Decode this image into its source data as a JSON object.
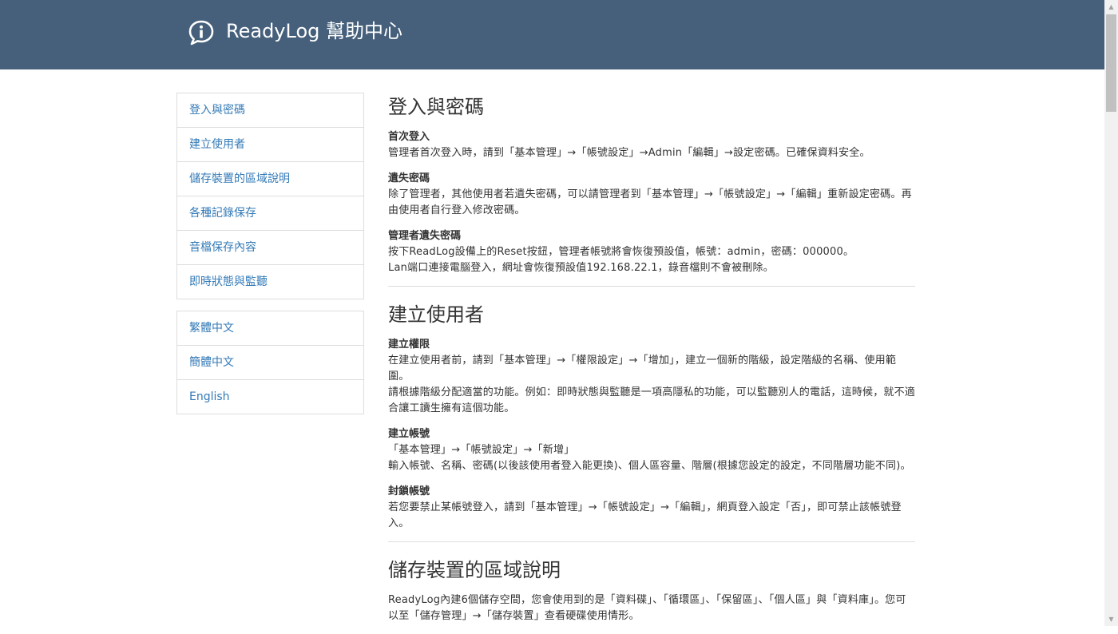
{
  "header": {
    "brand": "ReadyLog 幫助中心",
    "logo_icon": "info-chat-bubble-icon",
    "bg_color": "#46607c"
  },
  "sidebar": {
    "sections": [
      {
        "label": "登入與密碼"
      },
      {
        "label": "建立使用者"
      },
      {
        "label": "儲存裝置的區域說明"
      },
      {
        "label": "各種記錄保存"
      },
      {
        "label": "音檔保存內容"
      },
      {
        "label": "即時狀態與監聽"
      }
    ],
    "languages": [
      {
        "label": "繁體中文"
      },
      {
        "label": "簡體中文"
      },
      {
        "label": "English"
      }
    ]
  },
  "content": {
    "login": {
      "title": "登入與密碼",
      "first_login": {
        "heading": "首次登入",
        "text": "管理者首次登入時，請到「基本管理」→「帳號設定」→Admin「編輯」→設定密碼。已確保資料安全。"
      },
      "lost_password": {
        "heading": "遺失密碼",
        "text": "除了管理者，其他使用者若遺失密碼，可以請管理者到「基本管理」→「帳號設定」→「編輯」重新設定密碼。再由使用者自行登入修改密碼。"
      },
      "admin_lost": {
        "heading": "管理者遺失密碼",
        "text1": "按下ReadLog設備上的Reset按鈕，管理者帳號將會恢復預設值，帳號：admin，密碼：000000。",
        "text2": "Lan端口連接電腦登入，網址會恢復預設值192.168.22.1，錄音檔則不會被刪除。"
      }
    },
    "users": {
      "title": "建立使用者",
      "permissions": {
        "heading": "建立權限",
        "text1": "在建立使用者前，請到「基本管理」→「權限設定」→「增加」，建立一個新的階級，設定階級的名稱、使用範圍。",
        "text2": "請根據階級分配適當的功能。例如：即時狀態與監聽是一項高隱私的功能，可以監聽別人的電話，這時候，就不適合讓工讀生擁有這個功能。"
      },
      "account": {
        "heading": "建立帳號",
        "text1": "「基本管理」→「帳號設定」→「新增」",
        "text2": "輸入帳號、名稱、密碼(以後該使用者登入能更換)、個人區容量、階層(根據您設定的設定，不同階層功能不同)。"
      },
      "lock": {
        "heading": "封鎖帳號",
        "text": "若您要禁止某帳號登入，請到「基本管理」→「帳號設定」→「編輯」，網頁登入設定「否」，即可禁止該帳號登入。"
      }
    },
    "storage": {
      "title": "儲存裝置的區域說明",
      "text": "ReadyLog內建6個儲存空間，您會使用到的是「資料碟」、「循環區」、「保留區」、「個人區」與「資料庫」。您可以至「儲存管理」→「儲存裝置」查看硬碟使用情形。"
    }
  }
}
